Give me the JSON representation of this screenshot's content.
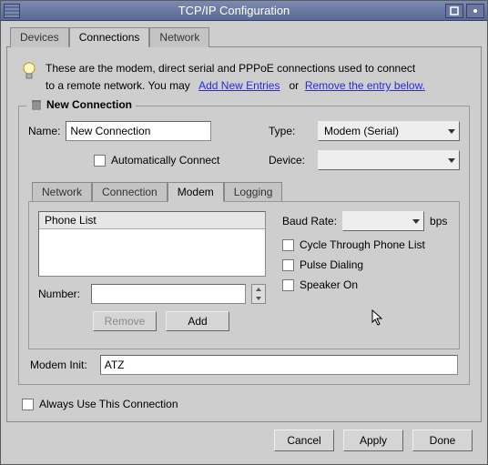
{
  "window": {
    "title": "TCP/IP Configuration"
  },
  "mainTabs": {
    "devices": "Devices",
    "connections": "Connections",
    "network": "Network"
  },
  "intro": {
    "line1": "These are the modem, direct serial and PPPoE connections used to connect",
    "line2a": "to a remote network. You may",
    "link_add": "Add New Entries",
    "or": "or",
    "link_remove": "Remove the entry below."
  },
  "group": {
    "legend": "New Connection"
  },
  "form": {
    "name_label": "Name:",
    "name_value": "New Connection",
    "auto_label": "Automatically Connect",
    "type_label": "Type:",
    "type_value": "Modem (Serial)",
    "device_label": "Device:",
    "device_value": ""
  },
  "innerTabs": {
    "network": "Network",
    "connection": "Connection",
    "modem": "Modem",
    "logging": "Logging"
  },
  "modem": {
    "phone_header": "Phone List",
    "number_label": "Number:",
    "number_value": "",
    "remove_btn": "Remove",
    "add_btn": "Add",
    "baud_label": "Baud Rate:",
    "baud_value": "",
    "baud_unit": "bps",
    "cycle_label": "Cycle Through Phone List",
    "pulse_label": "Pulse Dialing",
    "speaker_label": "Speaker On",
    "init_label": "Modem Init:",
    "init_value": "ATZ"
  },
  "always_label": "Always Use This Connection",
  "buttons": {
    "cancel": "Cancel",
    "apply": "Apply",
    "done": "Done"
  }
}
